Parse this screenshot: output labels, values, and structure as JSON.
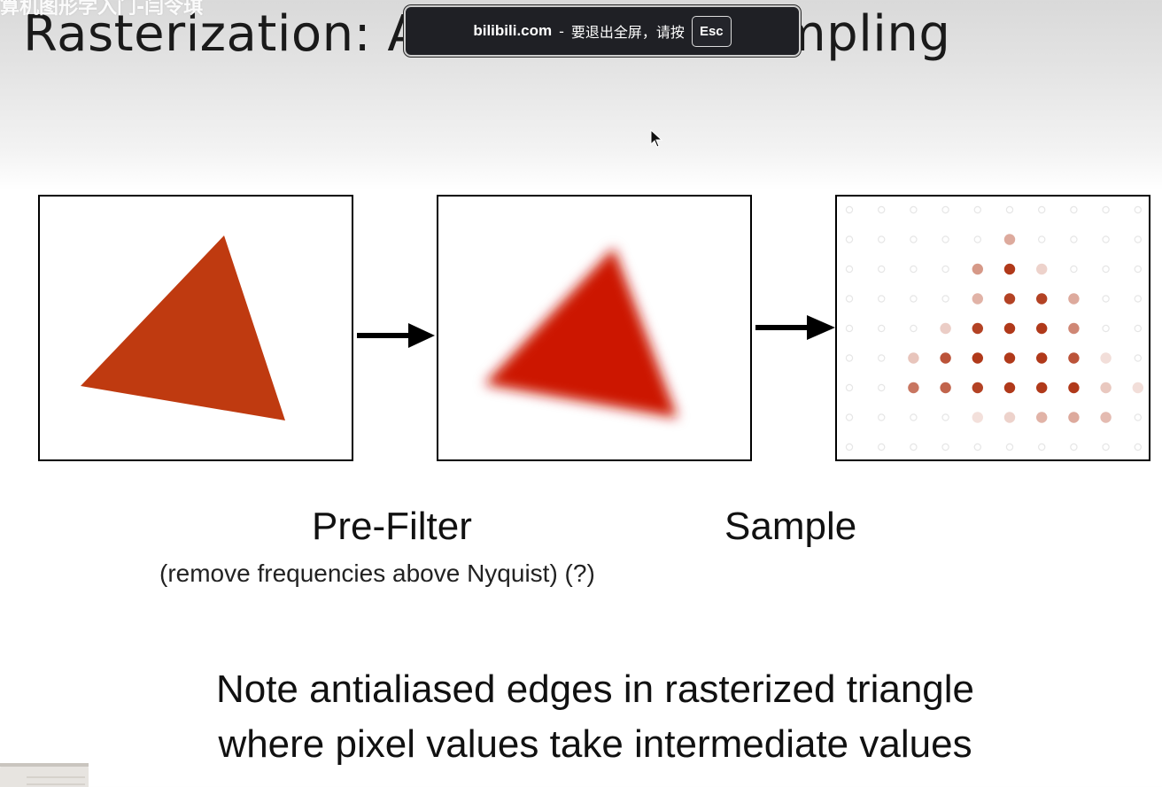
{
  "overlay": {
    "video_title": "算机图形学入门-闫令琪"
  },
  "slide": {
    "title": "Rasterization: A",
    "title_tail": "mpling",
    "captions": {
      "prefilter": "Pre-Filter",
      "prefilter_sub": "(remove frequencies above Nyquist) (?)",
      "sample": "Sample"
    },
    "note": {
      "line1": "Note antialiased edges in rasterized triangle",
      "line2": "where pixel values take intermediate values"
    },
    "colors": {
      "triangle": "#bf3a10",
      "blurred_triangle": "#cc1400",
      "sample_dot": "#b0391a",
      "frame": "#000000"
    },
    "sample_grid": {
      "rows": 9,
      "cols": 10,
      "intensity": [
        [
          0,
          0,
          0,
          0,
          0,
          0,
          0,
          0,
          0,
          0
        ],
        [
          0,
          0,
          0,
          0,
          0,
          0.35,
          0,
          0,
          0,
          0
        ],
        [
          0,
          0,
          0,
          0,
          0.45,
          1,
          0.12,
          0,
          0,
          0
        ],
        [
          0,
          0,
          0,
          0,
          0.3,
          0.95,
          0.95,
          0.35,
          0,
          0
        ],
        [
          0,
          0,
          0,
          0.15,
          0.95,
          1,
          1,
          0.55,
          0,
          0
        ],
        [
          0,
          0,
          0.2,
          0.85,
          1,
          1,
          1,
          0.85,
          0.05,
          0
        ],
        [
          0,
          0,
          0.65,
          0.75,
          0.95,
          1,
          1,
          1,
          0.18,
          0.05
        ],
        [
          0,
          0,
          0,
          0,
          0.04,
          0.12,
          0.3,
          0.35,
          0.25,
          0
        ],
        [
          0,
          0,
          0,
          0,
          0,
          0,
          0,
          0,
          0,
          0
        ]
      ]
    }
  },
  "fullscreen_notice": {
    "site": "bilibili.com",
    "separator": "-",
    "message": "要退出全屏，请按",
    "key_label": "Esc"
  }
}
